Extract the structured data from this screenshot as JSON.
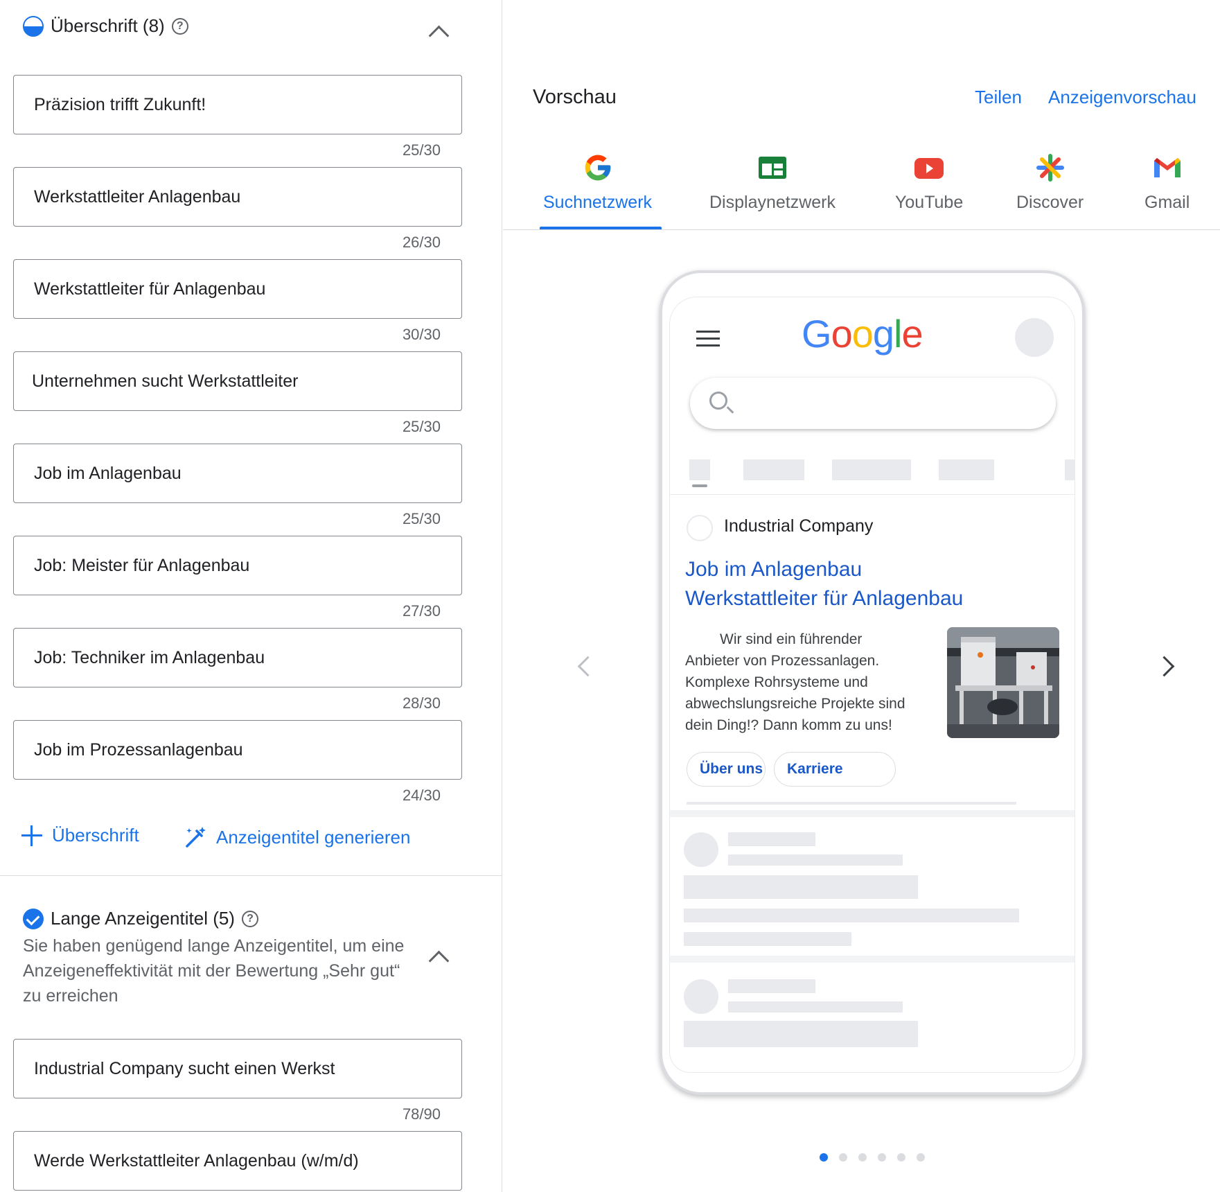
{
  "headlines": {
    "title": "Überschrift (8)",
    "items": [
      {
        "value": "Präzision trifft Zukunft!",
        "count": "25/30"
      },
      {
        "value": "Werkstattleiter Anlagenbau",
        "count": "26/30"
      },
      {
        "value": "Werkstattleiter für Anlagenbau",
        "count": "30/30"
      },
      {
        "value": "Unternehmen sucht Werkstattleiter",
        "count": "25/30"
      },
      {
        "value": "Job im Anlagenbau",
        "count": "25/30"
      },
      {
        "value": "Job: Meister für Anlagenbau",
        "count": "27/30"
      },
      {
        "value": "Job: Techniker im Anlagenbau",
        "count": "28/30"
      },
      {
        "value": "Job im Prozessanlagenbau",
        "count": "24/30"
      }
    ],
    "add_label": "Überschrift",
    "generate_label": "Anzeigentitel generieren"
  },
  "long_headlines": {
    "title": "Lange Anzeigentitel (5)",
    "description": "Sie haben genügend lange Anzeigentitel, um eine Anzeigeneffektivität mit der Bewertung „Sehr gut“ zu erreichen",
    "items": [
      {
        "value": "Industrial Company sucht einen Werkst",
        "count": "78/90"
      },
      {
        "value": "Werde Werkstattleiter Anlagenbau (w/m/d)"
      }
    ]
  },
  "preview": {
    "title": "Vorschau",
    "share": "Teilen",
    "ad_preview": "Anzeigenvorschau",
    "tabs": [
      "Suchnetzwerk",
      "Displaynetzwerk",
      "YouTube",
      "Discover",
      "Gmail"
    ],
    "active_tab": "Suchnetzwerk"
  },
  "phone": {
    "logo": "Google",
    "ad": {
      "company": "Industrial Company",
      "headline_1": "Job im Anlagenbau",
      "headline_2": "Werkstattleiter für Anlagenbau",
      "description": "Wir sind ein führender Anbieter von Prozessanlagen. Komplexe Rohrsysteme und abwechslungsreiche Projekte sind dein Ding!? Dann komm zu uns!",
      "sitelinks": [
        "Über uns",
        "Karriere"
      ]
    }
  },
  "pager": {
    "total": 6,
    "active": 1
  },
  "colors": {
    "accent": "#1a73e8",
    "link": "#1a57c8",
    "border": "#80868b",
    "divider": "#dadce0"
  }
}
